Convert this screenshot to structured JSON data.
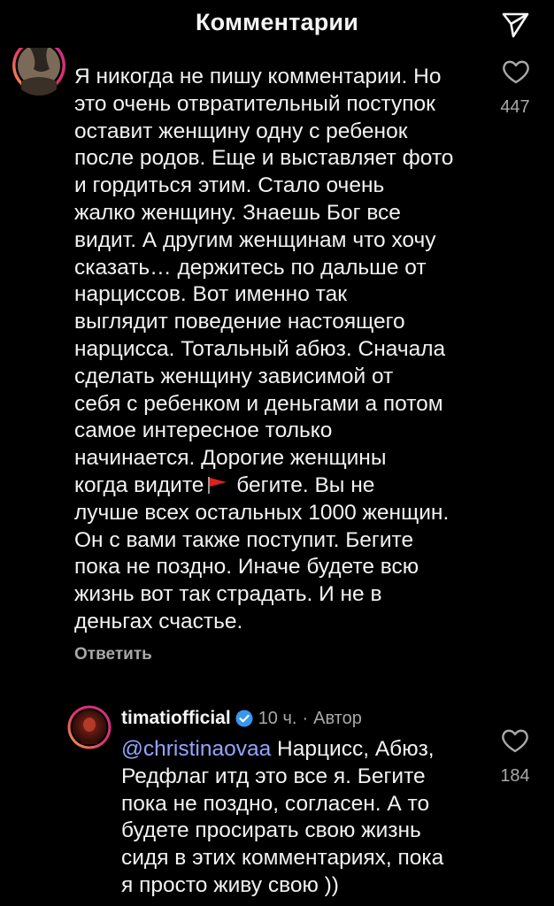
{
  "header": {
    "title": "Комментарии",
    "share_icon": "send-icon"
  },
  "comment": {
    "avatar_icon": "user-avatar",
    "text_part1": "Я никогда не пишу комментарии. Но\nэто очень отвратительный поступок\nоставит женщину одну с ребенок\nпосле родов. Еще и выставляет фото\nи гордиться этим. Стало очень\nжалко женщину. Знаешь Бог все\nвидит. А другим женщинам что хочу\nсказать… держитесь по дальше от\nнарциссов. Вот именно так\nвыглядит поведение настоящего\nнарцисса. Тотальный абюз. Сначала\nсделать женщину зависимой от\nсебя с ребенком и деньгами а потом\nсамое интересное только\nначинается. Дорогие женщины\nкогда видите",
    "flag_icon": "red-flag-emoji",
    "text_part2": "бегите. Вы не\nлучше всех остальных 1000 женщин.\nОн с вами также поступит. Бегите\nпока не поздно. Иначе будете всю\nжизнь вот так страдать. И не в\nденьгах счастье.",
    "like_count": "447",
    "reply_label": "Ответить"
  },
  "reply": {
    "username": "timatiofficial",
    "time": "10 ч.",
    "separator": "·",
    "author_label": "Автор",
    "mention": "@christinaovaa",
    "text": " Нарцисс, Абюз,\nРедфлаг итд это все я. Бегите\nпока не поздно, согласен. А то\nбудете просирать свою жизнь\nсидя в этих комментариях, пока\nя просто живу свою ))",
    "like_count": "184"
  },
  "colors": {
    "background": "#000000",
    "text": "#f2f2f2",
    "secondary": "#a8a8a8",
    "mention": "#93a5ff",
    "verified": "#3897f0",
    "story_ring": "#e1306c"
  }
}
